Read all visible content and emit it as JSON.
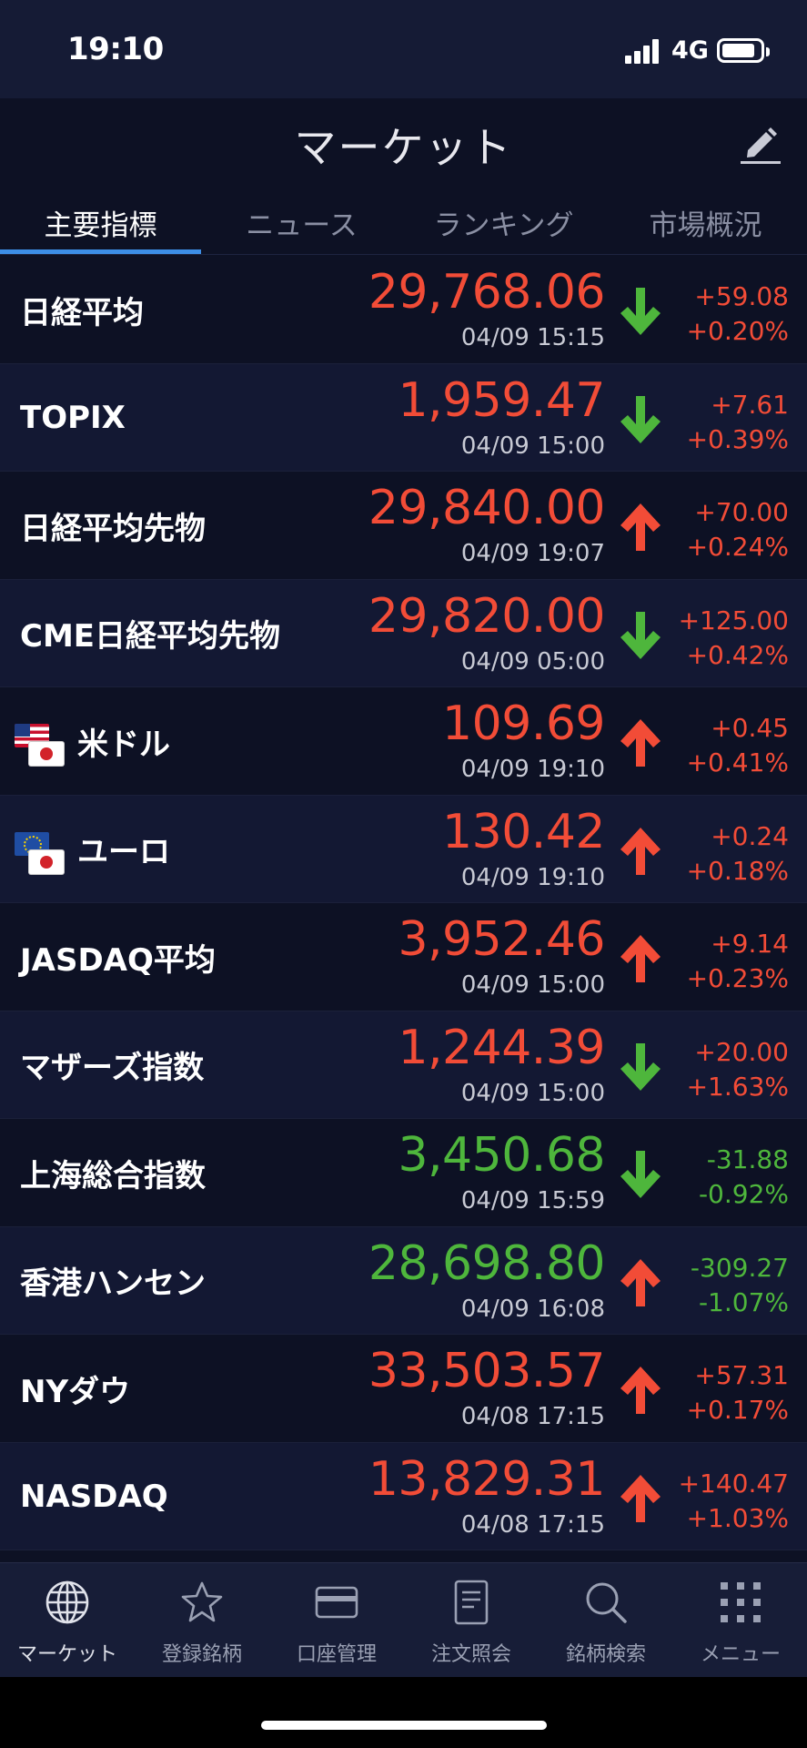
{
  "status": {
    "time": "19:10",
    "network": "4G"
  },
  "header": {
    "title": "マーケット"
  },
  "tabs": [
    {
      "label": "主要指標",
      "active": true
    },
    {
      "label": "ニュース",
      "active": false
    },
    {
      "label": "ランキング",
      "active": false
    },
    {
      "label": "市場概況",
      "active": false
    }
  ],
  "rows": [
    {
      "name": "日経平均",
      "price": "29,768.06",
      "time": "04/09 15:15",
      "arrow": "down",
      "change": "+59.08",
      "pct": "+0.20%",
      "price_color": "red",
      "change_color": "red"
    },
    {
      "name": "TOPIX",
      "price": "1,959.47",
      "time": "04/09 15:00",
      "arrow": "down",
      "change": "+7.61",
      "pct": "+0.39%",
      "price_color": "red",
      "change_color": "red"
    },
    {
      "name": "日経平均先物",
      "price": "29,840.00",
      "time": "04/09 19:07",
      "arrow": "up",
      "change": "+70.00",
      "pct": "+0.24%",
      "price_color": "red",
      "change_color": "red"
    },
    {
      "name": "CME日経平均先物",
      "price": "29,820.00",
      "time": "04/09 05:00",
      "arrow": "down",
      "change": "+125.00",
      "pct": "+0.42%",
      "price_color": "red",
      "change_color": "red"
    },
    {
      "name": "米ドル",
      "price": "109.69",
      "time": "04/09 19:10",
      "arrow": "up",
      "change": "+0.45",
      "pct": "+0.41%",
      "price_color": "red",
      "change_color": "red",
      "flag": "us"
    },
    {
      "name": "ユーロ",
      "price": "130.42",
      "time": "04/09 19:10",
      "arrow": "up",
      "change": "+0.24",
      "pct": "+0.18%",
      "price_color": "red",
      "change_color": "red",
      "flag": "eu"
    },
    {
      "name": "JASDAQ平均",
      "price": "3,952.46",
      "time": "04/09 15:00",
      "arrow": "up",
      "change": "+9.14",
      "pct": "+0.23%",
      "price_color": "red",
      "change_color": "red"
    },
    {
      "name": "マザーズ指数",
      "price": "1,244.39",
      "time": "04/09 15:00",
      "arrow": "down",
      "change": "+20.00",
      "pct": "+1.63%",
      "price_color": "red",
      "change_color": "red"
    },
    {
      "name": "上海総合指数",
      "price": "3,450.68",
      "time": "04/09 15:59",
      "arrow": "down",
      "change": "-31.88",
      "pct": "-0.92%",
      "price_color": "green",
      "change_color": "green"
    },
    {
      "name": "香港ハンセン",
      "price": "28,698.80",
      "time": "04/09 16:08",
      "arrow": "up",
      "change": "-309.27",
      "pct": "-1.07%",
      "price_color": "green",
      "change_color": "green"
    },
    {
      "name": "NYダウ",
      "price": "33,503.57",
      "time": "04/08 17:15",
      "arrow": "up",
      "change": "+57.31",
      "pct": "+0.17%",
      "price_color": "red",
      "change_color": "red"
    },
    {
      "name": "NASDAQ",
      "price": "13,829.31",
      "time": "04/08 17:15",
      "arrow": "up",
      "change": "+140.47",
      "pct": "+1.03%",
      "price_color": "red",
      "change_color": "red"
    }
  ],
  "tabbar": [
    {
      "label": "マーケット",
      "icon": "globe-icon",
      "active": true
    },
    {
      "label": "登録銘柄",
      "icon": "star-icon",
      "active": false
    },
    {
      "label": "口座管理",
      "icon": "card-icon",
      "active": false
    },
    {
      "label": "注文照会",
      "icon": "document-icon",
      "active": false
    },
    {
      "label": "銘柄検索",
      "icon": "search-icon",
      "active": false
    },
    {
      "label": "メニュー",
      "icon": "grid-icon",
      "active": false
    }
  ],
  "colors": {
    "up": "#f24c37",
    "down": "#4eb63c",
    "accent": "#3d8ee6",
    "background": "#0d1124"
  }
}
